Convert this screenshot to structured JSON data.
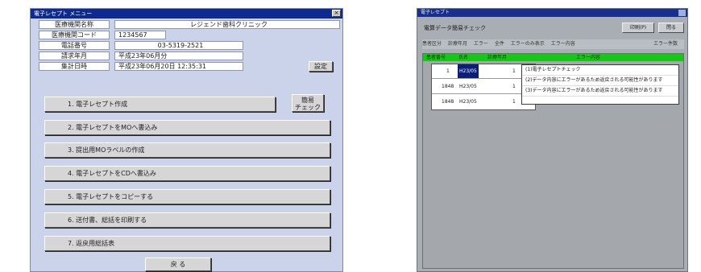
{
  "left_window": {
    "title": "電子レセプト メニュー",
    "info": [
      {
        "label": "医療機関名称",
        "value": "レジェンド歯科クリニック"
      },
      {
        "label": "医療機関コード",
        "value": "1234567"
      },
      {
        "label": "電話番号",
        "value": "03-5319-2521"
      },
      {
        "label": "請求年月",
        "value": "平成23年06月分"
      },
      {
        "label": "集計日時",
        "value": "平成23年06月20日 12:35:31"
      }
    ],
    "settings_button": "設定",
    "simple_check_button": "簡易\nチェック",
    "menu": [
      "1. 電子レセプト作成",
      "2. 電子レセプトをMOへ書込み",
      "3. 提出用MOラベルの作成",
      "4. 電子レセプトをCDへ書込み",
      "5. 電子レセプトをコピーする",
      "6. 送付書、総括を印刷する",
      "7. 返戻用総括表"
    ],
    "back_button": "戻 る"
  },
  "right_window": {
    "title": "電子レセプト",
    "header_title": "電算データ簡易チェック",
    "header_buttons": [
      "印刷(P)",
      "閉る"
    ],
    "filter_items": [
      "患者区分",
      "診療年月",
      "エラー",
      "全件",
      "エラーのみ表示",
      "エラー内容"
    ],
    "filter_right": "エラー件数",
    "columns": [
      "患者番号",
      "氏名",
      "診療年月",
      "エラー内容"
    ],
    "rows": [
      {
        "id": "1",
        "date": "H23/05",
        "code": "1"
      },
      {
        "id": "1848",
        "date": "H23/05",
        "code": "1"
      },
      {
        "id": "1848",
        "date": "H23/05",
        "code": "1"
      }
    ],
    "popup_lines": [
      "(1)電子レセプトチェック",
      "(2)データ内容にエラーがあるため返戻される可能性があります",
      "(3)データ内容にエラーがあるため返戻される可能性があります"
    ]
  },
  "colors": {
    "left_bg": "#cbd3eb",
    "title_bar": "#0c2a8f",
    "grid_header": "#13c913",
    "selection": "#0a1f7a"
  }
}
